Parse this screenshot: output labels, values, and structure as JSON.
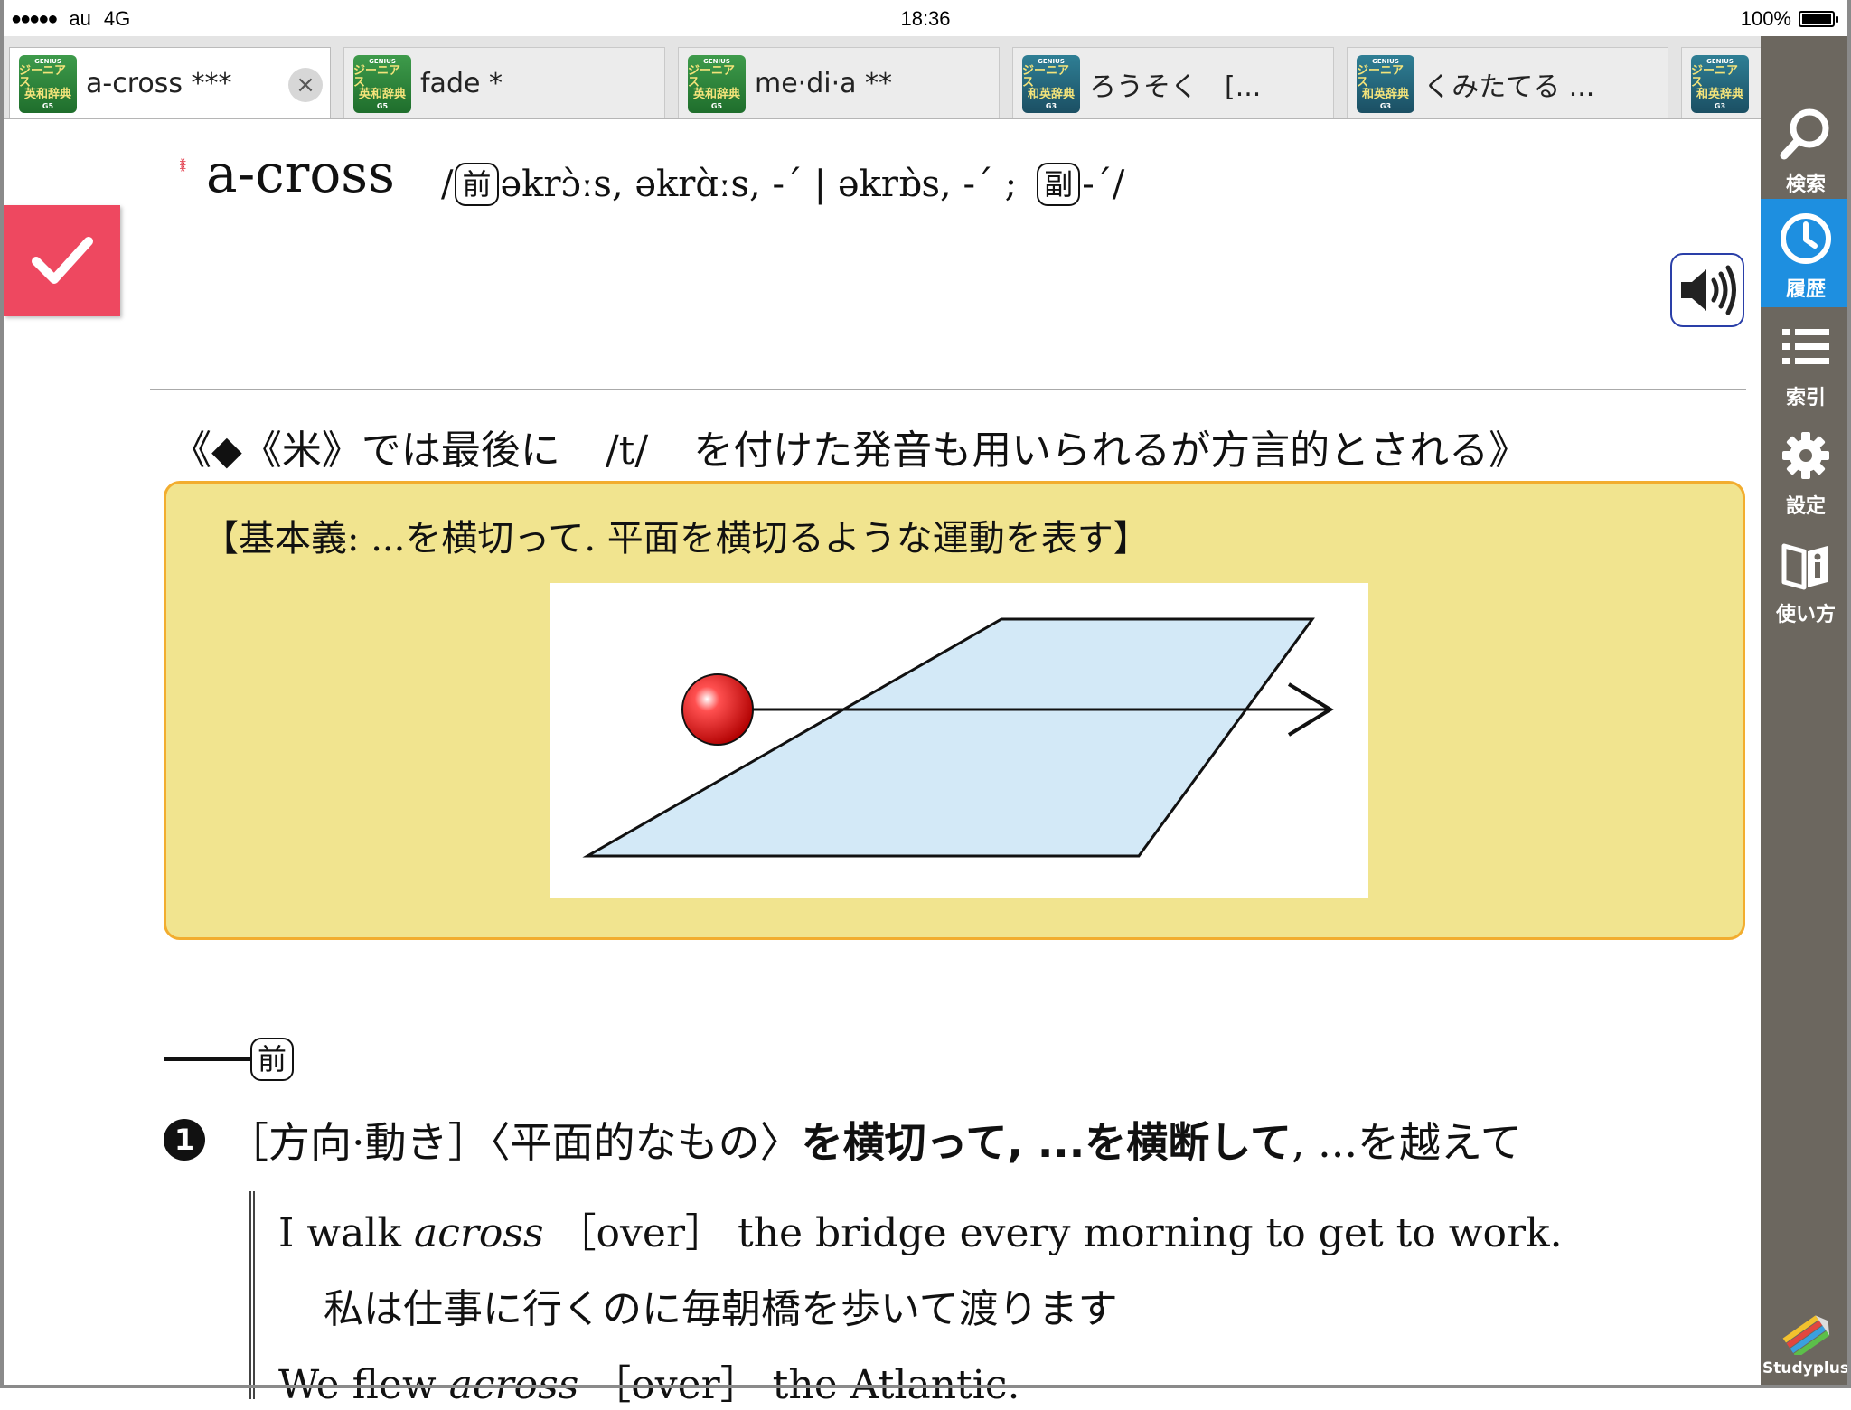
{
  "status": {
    "carrier": "au",
    "network": "4G",
    "time": "18:36",
    "battery": "100%"
  },
  "tabs": [
    {
      "label": "a-cross ***",
      "badge": {
        "l1": "GENIUS",
        "l2a": "ジーニアス",
        "l2b": "英和辞典",
        "l3": "G5",
        "color": "#2a8a3a"
      },
      "active": true
    },
    {
      "label": "fade *",
      "badge": {
        "l1": "GENIUS",
        "l2a": "ジーニアス",
        "l2b": "英和辞典",
        "l3": "G5",
        "color": "#2a8a3a"
      }
    },
    {
      "label": "me·di·a **",
      "badge": {
        "l1": "GENIUS",
        "l2a": "ジーニアス",
        "l2b": "英和辞典",
        "l3": "G5",
        "color": "#2a8a3a"
      }
    },
    {
      "label": "ろうそく　[...",
      "badge": {
        "l1": "GENIUS",
        "l2a": "ジーニアス",
        "l2b": "和英辞典",
        "l3": "G3",
        "color": "#226a80"
      }
    },
    {
      "label": "くみたてる ...",
      "badge": {
        "l1": "GENIUS",
        "l2a": "ジーニアス",
        "l2b": "和英辞典",
        "l3": "G3",
        "color": "#226a80"
      }
    },
    {
      "label": "",
      "badge": {
        "l1": "GENIUS",
        "l2a": "ジーニアス",
        "l2b": "和英辞典",
        "l3": "G3",
        "color": "#226a80"
      }
    }
  ],
  "tab_close": "×",
  "sidebar": {
    "items": [
      {
        "label": "検索",
        "icon": "search-icon"
      },
      {
        "label": "履歴",
        "icon": "clock-icon",
        "active": true
      },
      {
        "label": "索引",
        "icon": "list-icon"
      },
      {
        "label": "設定",
        "icon": "gear-icon"
      },
      {
        "label": "使い方",
        "icon": "info-book-icon"
      }
    ],
    "studyplus": "Studyplus"
  },
  "entry": {
    "stars": "***",
    "headword": "a-cross",
    "pron_open": "/",
    "pos1": "前",
    "pron_text": "əkrɔ̀ːs, əkrɑ̀ːs, -ˊ | əkrɒ̀s, -ˊ ;",
    "pos2": "副",
    "pron_close": "-ˊ/",
    "note_a": "《◆《米》では最後に",
    "note_b": "/t/",
    "note_c": "を付けた発音も用いられるが方言的とされる》",
    "core_title": "【基本義: ...を横切って. 平面を横切るような運動を表す】",
    "section_pos": "前",
    "sense_num": "1",
    "sense_a": "［方向·動き］〈平面的なもの〉",
    "sense_b": "を横切って, ...を横断して",
    "sense_c": ", ...を越えて",
    "ex1_a": "I walk",
    "ex1_b": "across",
    "ex1_c": "［over］ the bridge every morning to get to work.",
    "ex1_ja": "私は仕事に行くのに毎朝橋を歩いて渡ります",
    "ex2_a": "We flew",
    "ex2_b": "across",
    "ex2_c": "［over］ the Atlantic."
  },
  "colors": {
    "check": "#ee4860",
    "sidebar": "#6c675f",
    "active": "#1e8fe0",
    "core_bg": "#f1e48f",
    "core_border": "#f2ad2f",
    "plane": "#d3e9f7",
    "ball": "#e01010"
  }
}
